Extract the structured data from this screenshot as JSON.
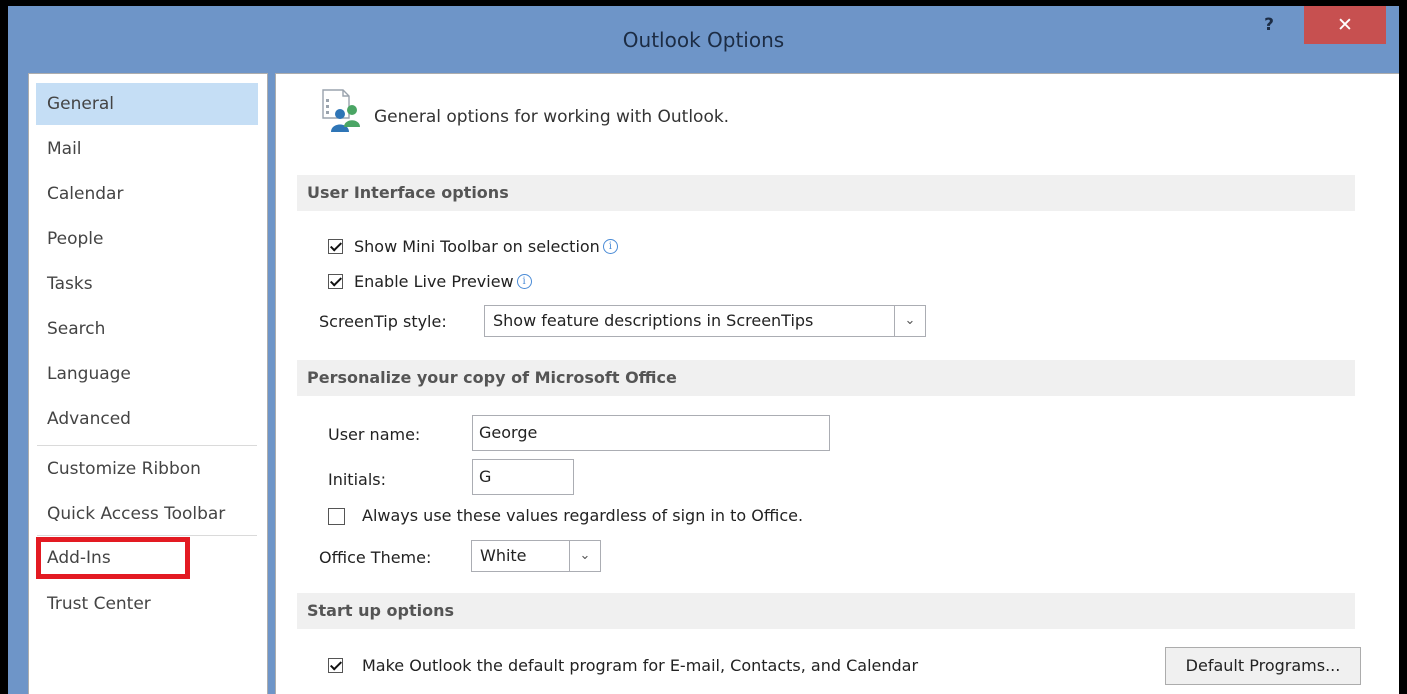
{
  "window": {
    "title": "Outlook Options",
    "help": "?",
    "close": "✕"
  },
  "nav": {
    "items": [
      {
        "label": "General"
      },
      {
        "label": "Mail"
      },
      {
        "label": "Calendar"
      },
      {
        "label": "People"
      },
      {
        "label": "Tasks"
      },
      {
        "label": "Search"
      },
      {
        "label": "Language"
      },
      {
        "label": "Advanced"
      },
      {
        "label": "Customize Ribbon"
      },
      {
        "label": "Quick Access Toolbar"
      },
      {
        "label": "Add-Ins"
      },
      {
        "label": "Trust Center"
      }
    ],
    "selected": "General",
    "highlighted": "Add-Ins"
  },
  "content": {
    "header_text": "General options for working with Outlook.",
    "header_icon": "general-options-icon",
    "ui_section": {
      "title": "User Interface options",
      "mini_toolbar": {
        "label": "Show Mini Toolbar on selection",
        "checked": true
      },
      "live_preview": {
        "label": "Enable Live Preview",
        "checked": true
      },
      "screentip_label": "ScreenTip style:",
      "screentip_value": "Show feature descriptions in ScreenTips"
    },
    "personalize_section": {
      "title": "Personalize your copy of Microsoft Office",
      "username_label": "User name:",
      "username_value": "George",
      "initials_label": "Initials:",
      "initials_value": "G",
      "always_use": {
        "label": "Always use these values regardless of sign in to Office.",
        "checked": false
      },
      "theme_label": "Office Theme:",
      "theme_value": "White"
    },
    "startup_section": {
      "title": "Start up options",
      "default_program": {
        "label": "Make Outlook the default program for E-mail, Contacts, and Calendar",
        "checked": true
      },
      "default_programs_button": "Default Programs..."
    }
  },
  "colors": {
    "titlebar": "#6e95c8",
    "close": "#c75050",
    "selected_nav": "#c5def5",
    "highlight": "#e31a22"
  }
}
